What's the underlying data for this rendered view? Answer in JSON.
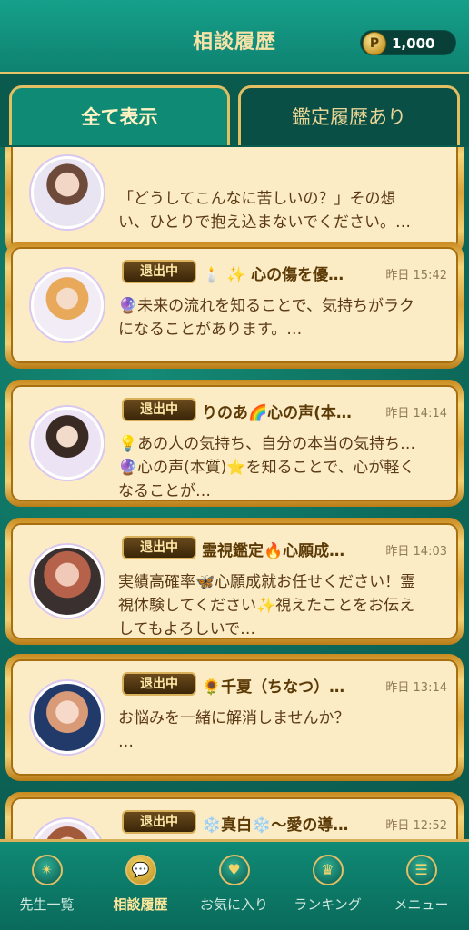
{
  "header": {
    "title": "相談履歴",
    "points_symbol": "P",
    "points": "1,000"
  },
  "tabs": [
    {
      "label": "全て表示",
      "active": true
    },
    {
      "label": "鑑定履歴あり",
      "active": false
    }
  ],
  "conversations": [
    {
      "name": "",
      "time": "",
      "badge": "",
      "message": "「どうしてこんなに苦しいの？」その想い、ひとりで抱え込まないでください。…"
    },
    {
      "name": "🕯️ ✨ 心の傷を優…",
      "time": "昨日 15:42",
      "badge": "退出中",
      "message": "🔮未来の流れを知ることで、気持ちがラクになることがあります。…"
    },
    {
      "name": "りのあ🌈心の声(本…",
      "time": "昨日 14:14",
      "badge": "退出中",
      "message": "💡あの人の気持ち、自分の本当の気持ち…🔮心の声(本質)⭐を知ることで、心が軽くなることが…"
    },
    {
      "name": "霊視鑑定🔥心願成…",
      "time": "昨日 14:03",
      "badge": "退出中",
      "message": "実績高確率🦋心願成就お任せください！霊視体験してください✨視えたことをお伝えしてもよろしいで…"
    },
    {
      "name": "🌻千夏（ちなつ）…",
      "time": "昨日 13:14",
      "badge": "退出中",
      "message": "お悩みを一緒に解消しませんか？\n…"
    },
    {
      "name": "❄️真白❄️〜愛の導…",
      "time": "昨日 12:52",
      "badge": "退出中",
      "message": ""
    }
  ],
  "nav": [
    {
      "label": "先生一覧",
      "icon": "compass-star-icon",
      "glyph": "✴"
    },
    {
      "label": "相談履歴",
      "icon": "chat-bubble-icon",
      "glyph": "💬",
      "active": true
    },
    {
      "label": "お気に入り",
      "icon": "heart-icon",
      "glyph": "♥"
    },
    {
      "label": "ランキング",
      "icon": "crown-icon",
      "glyph": "♛"
    },
    {
      "label": "メニュー",
      "icon": "menu-list-icon",
      "glyph": "☰"
    }
  ],
  "colors": {
    "accent_gold": "#e6c46a",
    "teal": "#0f8a75",
    "card_bg": "#fcecc6"
  }
}
